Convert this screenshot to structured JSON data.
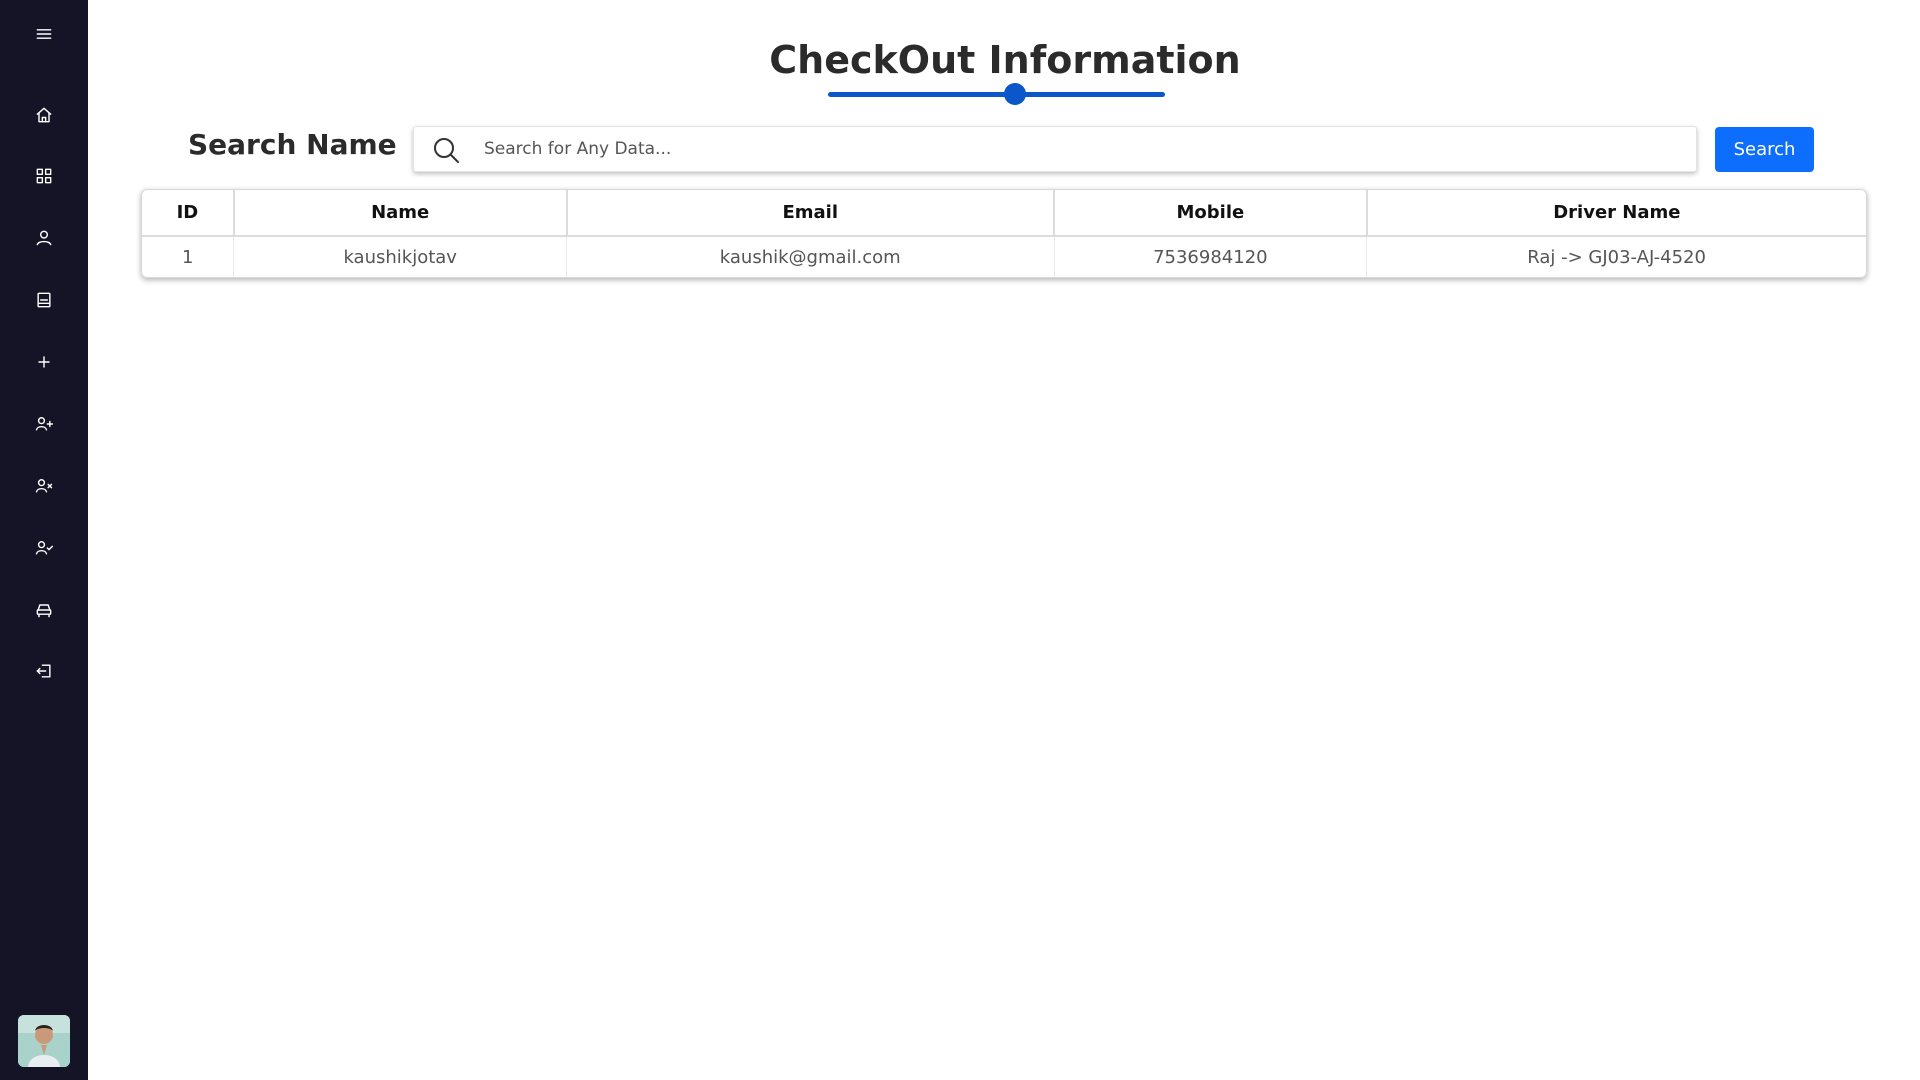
{
  "sidebar": {
    "items": [
      {
        "icon": "menu-icon"
      },
      {
        "icon": "home-icon"
      },
      {
        "icon": "dashboard-grid-icon"
      },
      {
        "icon": "user-icon"
      },
      {
        "icon": "document-icon"
      },
      {
        "icon": "plus-icon"
      },
      {
        "icon": "user-plus-icon"
      },
      {
        "icon": "user-x-icon"
      },
      {
        "icon": "user-check-icon"
      },
      {
        "icon": "car-icon"
      },
      {
        "icon": "logout-icon"
      }
    ],
    "avatar": "user-avatar"
  },
  "header": {
    "title": "CheckOut Information",
    "accent_color": "#0b56c8"
  },
  "search": {
    "label": "Search Name",
    "placeholder": "Search for Any Data...",
    "value": "",
    "button_label": "Search",
    "button_color": "#0d6efd"
  },
  "table": {
    "columns": [
      "ID",
      "Name",
      "Email",
      "Mobile",
      "Driver Name"
    ],
    "rows": [
      [
        "1",
        "kaushikjotav",
        "kaushik@gmail.com",
        "7536984120",
        "Raj -> GJ03-AJ-4520"
      ]
    ]
  },
  "colors": {
    "sidebar_bg": "#141426",
    "background": "#ffffff"
  }
}
